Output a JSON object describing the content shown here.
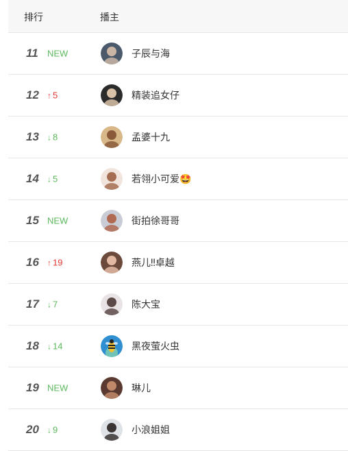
{
  "header": {
    "rank_label": "排行",
    "streamer_label": "播主"
  },
  "rows": [
    {
      "rank": "11",
      "change": "NEW",
      "change_type": "new",
      "name": "子辰与海",
      "avatar_icon": "avatar-photo",
      "avatar_colors": [
        "#4a5a6a",
        "#c9b6a4"
      ]
    },
    {
      "rank": "12",
      "change": "5",
      "change_type": "up",
      "name": "精装追女仔",
      "avatar_icon": "avatar-photo",
      "avatar_colors": [
        "#2b2b2b",
        "#d9c2a8"
      ]
    },
    {
      "rank": "13",
      "change": "8",
      "change_type": "down",
      "name": "孟婆十九",
      "avatar_icon": "avatar-photo",
      "avatar_colors": [
        "#d8b888",
        "#8a5a3a"
      ]
    },
    {
      "rank": "14",
      "change": "5",
      "change_type": "down",
      "name": "若翎小可爱🤩",
      "avatar_icon": "avatar-photo",
      "avatar_colors": [
        "#f1e4dc",
        "#a56e52"
      ]
    },
    {
      "rank": "15",
      "change": "NEW",
      "change_type": "new",
      "name": "街拍徐哥哥",
      "avatar_icon": "avatar-photo",
      "avatar_colors": [
        "#c9ccd4",
        "#b06a52"
      ]
    },
    {
      "rank": "16",
      "change": "19",
      "change_type": "up",
      "name": "燕儿‼卓越",
      "avatar_icon": "avatar-photo",
      "avatar_colors": [
        "#6b4a3c",
        "#e2b9a3"
      ]
    },
    {
      "rank": "17",
      "change": "7",
      "change_type": "down",
      "name": "陈大宝",
      "avatar_icon": "avatar-photo",
      "avatar_colors": [
        "#e9e3e6",
        "#5c4a48"
      ]
    },
    {
      "rank": "18",
      "change": "14",
      "change_type": "down",
      "name": "黑夜萤火虫",
      "avatar_icon": "bee-icon",
      "avatar_colors": [
        "#2f8fd0",
        "#f2c230"
      ]
    },
    {
      "rank": "19",
      "change": "NEW",
      "change_type": "new",
      "name": "琳儿",
      "avatar_icon": "avatar-photo",
      "avatar_colors": [
        "#5a3a30",
        "#c08a6a"
      ]
    },
    {
      "rank": "20",
      "change": "9",
      "change_type": "down",
      "name": "小浪姐姐",
      "avatar_icon": "avatar-photo",
      "avatar_colors": [
        "#dfe3e8",
        "#3a3434"
      ]
    }
  ],
  "colors": {
    "up": "#e53935",
    "down": "#5cb85c",
    "new": "#5cb85c",
    "header_bg": "#f7f7f7",
    "divider": "#e6e6e6"
  },
  "icons": {
    "up": "↑",
    "down": "↓"
  }
}
